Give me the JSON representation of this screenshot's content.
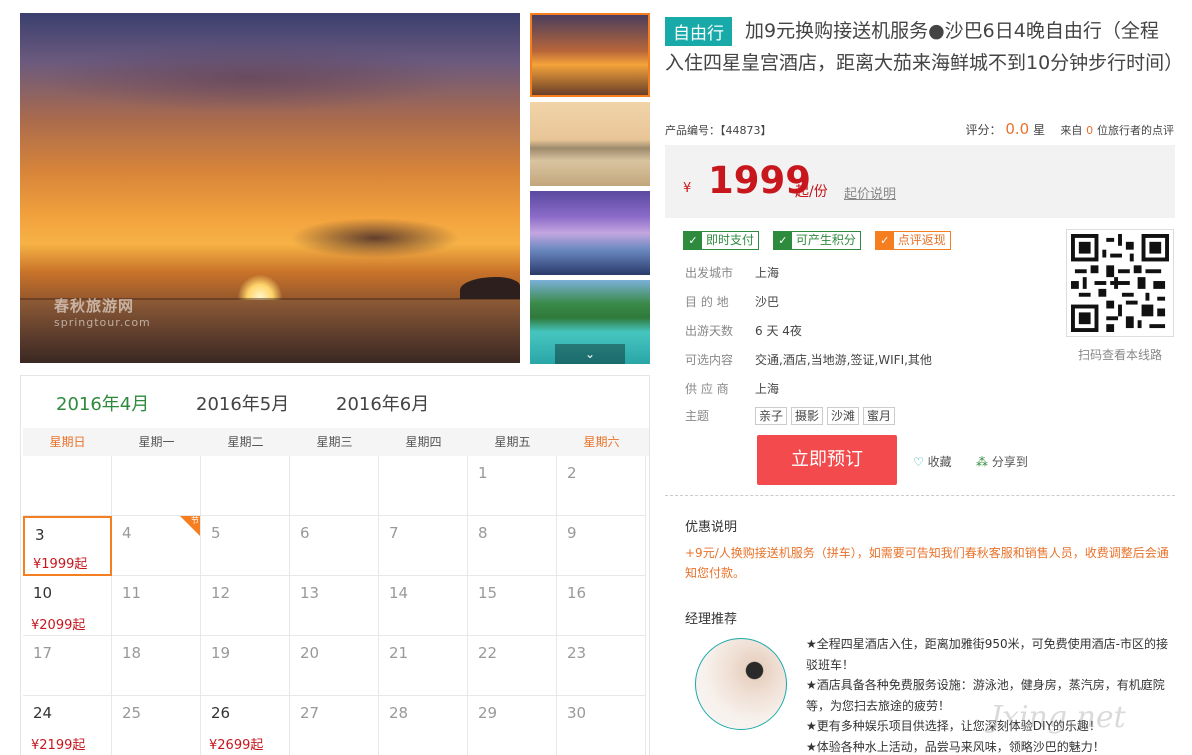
{
  "gallery": {
    "watermark_cn": "春秋旅游网",
    "watermark_en": "springtour.com",
    "thumb_arrow": "⌄"
  },
  "calendar": {
    "months": [
      "2016年4月",
      "2016年5月",
      "2016年6月"
    ],
    "active_month": 0,
    "weekdays": [
      "星期日",
      "星期一",
      "星期二",
      "星期三",
      "星期四",
      "星期五",
      "星期六"
    ],
    "flag_label": "节",
    "weeks": [
      [
        {
          "d": ""
        },
        {
          "d": ""
        },
        {
          "d": ""
        },
        {
          "d": ""
        },
        {
          "d": ""
        },
        {
          "d": "1"
        },
        {
          "d": "2"
        }
      ],
      [
        {
          "d": "3",
          "price": "¥1999起",
          "selected": true
        },
        {
          "d": "4",
          "flag": true
        },
        {
          "d": "5"
        },
        {
          "d": "6"
        },
        {
          "d": "7"
        },
        {
          "d": "8"
        },
        {
          "d": "9"
        }
      ],
      [
        {
          "d": "10",
          "price": "¥2099起"
        },
        {
          "d": "11"
        },
        {
          "d": "12"
        },
        {
          "d": "13"
        },
        {
          "d": "14"
        },
        {
          "d": "15"
        },
        {
          "d": "16"
        }
      ],
      [
        {
          "d": "17"
        },
        {
          "d": "18"
        },
        {
          "d": "19"
        },
        {
          "d": "20"
        },
        {
          "d": "21"
        },
        {
          "d": "22"
        },
        {
          "d": "23"
        }
      ],
      [
        {
          "d": "24",
          "price": "¥2199起"
        },
        {
          "d": "25"
        },
        {
          "d": "26",
          "price": "¥2699起"
        },
        {
          "d": "27"
        },
        {
          "d": "28"
        },
        {
          "d": "29"
        },
        {
          "d": "30"
        }
      ]
    ]
  },
  "product": {
    "badge": "自由行",
    "title": "加9元换购接送机服务●沙巴6日4晚自由行（全程入住四星皇宫酒店，距离大茄来海鲜城不到10分钟步行时间）",
    "code": "产品编号：【44873】",
    "rating_label": "评分：",
    "rating_value": "0.0",
    "rating_unit": "星",
    "reviews_prefix": "来自",
    "reviews_count": "0",
    "reviews_suffix": "位旅行者的点评"
  },
  "price": {
    "currency": "¥",
    "amount": "1999",
    "unit": "起/份",
    "explain": "起价说明"
  },
  "tags": [
    {
      "label": "即时支付",
      "color": "green"
    },
    {
      "label": "可产生积分",
      "color": "green"
    },
    {
      "label": "点评返现",
      "color": "orange"
    }
  ],
  "info": {
    "depart_label": "出发城市",
    "depart_value": "上海",
    "dest_label": "目 的 地",
    "dest_value": "沙巴",
    "days_label": "出游天数",
    "days_value": "6 天 4夜",
    "options_label": "可选内容",
    "options_value": "交通,酒店,当地游,签证,WIFI,其他",
    "supplier_label": "供 应 商",
    "supplier_value": "上海",
    "theme_label": "主题",
    "themes": [
      "亲子",
      "摄影",
      "沙滩",
      "蜜月"
    ]
  },
  "qr_caption": "扫码查看本线路",
  "actions": {
    "book": "立即预订",
    "favorite": "收藏",
    "share": "分享到"
  },
  "promo": {
    "title": "优惠说明",
    "text": "+9元/人换购接送机服务（拼车），如需要可告知我们春秋客服和销售人员，收费调整后会通知您付款。"
  },
  "manager": {
    "title": "经理推荐",
    "lines": [
      "★全程四星酒店入住，距离加雅街950米，可免费使用酒店-市区的接驳班车！",
      "★酒店具备各种免费服务设施：游泳池，健身房，蒸汽房，有机庭院等，为您扫去旅途的疲劳！",
      "★更有多种娱乐项目供选择，让您深刻体验DIY的乐趣！",
      "★体验各种水上活动，品尝马来风味，领略沙巴的魅力！"
    ]
  },
  "watermark": "Jxing.net"
}
